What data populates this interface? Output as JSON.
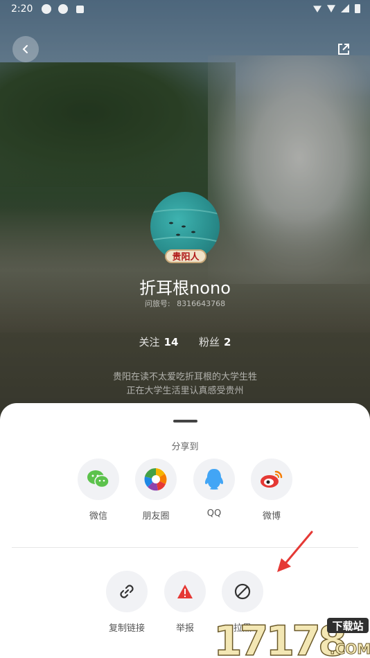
{
  "status": {
    "time": "2:20"
  },
  "profile": {
    "badge": "贵阳人",
    "name": "折耳根nono",
    "id_label": "问旅号:",
    "id_value": "8316643768",
    "follow_label": "关注",
    "follow_count": "14",
    "fans_label": "粉丝",
    "fans_count": "2",
    "bio_lines": [
      "贵阳在读不太爱吃折耳根的大学生牲",
      "正在大学生活里认真感受贵州"
    ]
  },
  "sheet": {
    "title": "分享到",
    "share_options": [
      {
        "label": "微信",
        "icon": "wechat-icon"
      },
      {
        "label": "朋友圈",
        "icon": "moments-icon"
      },
      {
        "label": "QQ",
        "icon": "qq-icon"
      },
      {
        "label": "微博",
        "icon": "weibo-icon"
      }
    ],
    "actions": [
      {
        "label": "复制链接",
        "icon": "link-icon"
      },
      {
        "label": "举报",
        "icon": "warning-icon"
      },
      {
        "label": "拉黑",
        "icon": "block-icon"
      }
    ]
  },
  "colors": {
    "accent_red": "#e53935",
    "circle_bg": "#f1f2f5"
  },
  "watermark": {
    "text": "17178",
    "sub": "下载站",
    "domain": ".COM"
  }
}
